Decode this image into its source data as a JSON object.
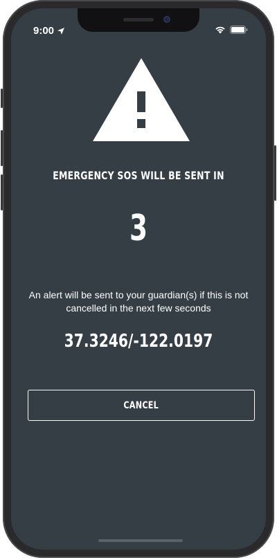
{
  "status_bar": {
    "time": "9:00",
    "location_icon": "location-arrow-icon",
    "wifi_icon": "wifi-icon",
    "battery_icon": "battery-icon"
  },
  "alert": {
    "icon": "warning-triangle-icon",
    "heading": "EMERGENCY SOS WILL BE SENT IN",
    "countdown": "3",
    "message": "An alert will be sent to your guardian(s) if this is not cancelled in the next few seconds",
    "coordinates": "37.3246/-122.0197"
  },
  "actions": {
    "cancel_label": "CANCEL"
  },
  "colors": {
    "background": "#353e45",
    "text": "#ffffff"
  }
}
